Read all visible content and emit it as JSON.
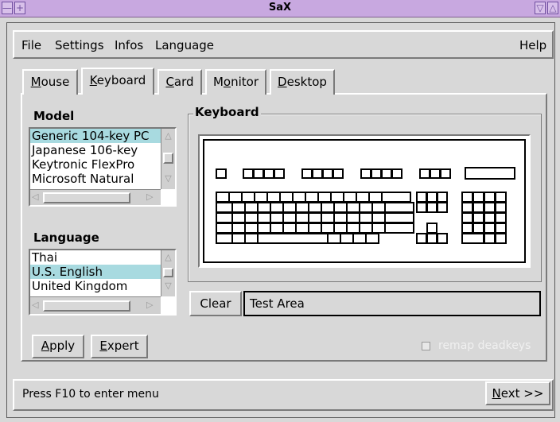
{
  "window": {
    "title": "SaX",
    "left_controls": [
      "—",
      "+"
    ],
    "right_controls": [
      "▽",
      "△"
    ]
  },
  "menubar": {
    "items": [
      "File",
      "Settings",
      "Infos",
      "Language"
    ],
    "help": "Help"
  },
  "tabs": [
    {
      "label": "Mouse",
      "mnemonic_index": 0
    },
    {
      "label": "Keyboard",
      "mnemonic_index": 0
    },
    {
      "label": "Card",
      "mnemonic_index": 0
    },
    {
      "label": "Monitor",
      "mnemonic_index": 1
    },
    {
      "label": "Desktop",
      "mnemonic_index": 0
    }
  ],
  "active_tab": "Keyboard",
  "model": {
    "label": "Model",
    "items": [
      "Generic 104-key PC",
      "Japanese 106-key",
      "Keytronic FlexPro",
      "Microsoft Natural"
    ],
    "selected": "Generic 104-key PC"
  },
  "language": {
    "label": "Language",
    "items": [
      "Thai",
      "U.S. English",
      "United Kingdom"
    ],
    "selected": "U.S. English"
  },
  "keyboard_group": {
    "label": "Keyboard"
  },
  "buttons": {
    "apply": "Apply",
    "expert": "Expert",
    "clear": "Clear",
    "next": "Next >>"
  },
  "test_area": {
    "value": "Test Area"
  },
  "remap_deadkeys": {
    "label": "remap deadkeys",
    "checked": false,
    "enabled": false
  },
  "status": {
    "text": "Press F10 to enter menu"
  }
}
